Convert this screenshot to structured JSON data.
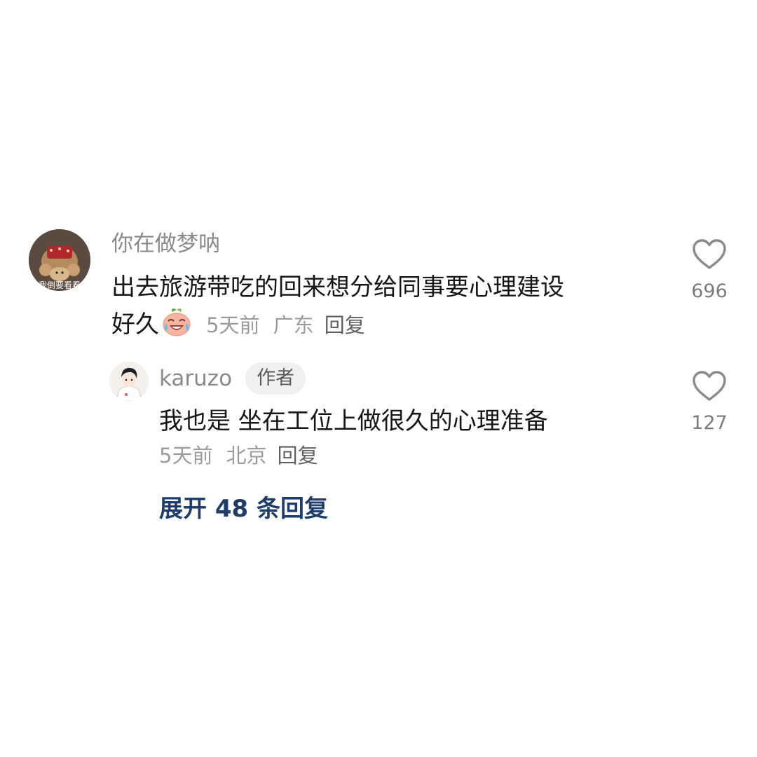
{
  "comment": {
    "username": "你在做梦呐",
    "avatar_caption": "我倒要看看",
    "text_line1": "出去旅游带吃的回来想分给同事要心理建设",
    "text_line2": "好久",
    "emoji": "crying-laughing-emoji",
    "time": "5天前",
    "location": "广东",
    "reply_label": "回复",
    "likes": "696"
  },
  "reply": {
    "username": "karuzo",
    "author_badge": "作者",
    "text": "我也是 坐在工位上做很久的心理准备",
    "time": "5天前",
    "location": "北京",
    "reply_label": "回复",
    "likes": "127"
  },
  "expand_replies": "展开 48 条回复",
  "icons": {
    "like": "heart-outline-icon"
  },
  "colors": {
    "username": "#8a8a8a",
    "text": "#161616",
    "meta": "#9b9b9b",
    "link": "#1f3d6b"
  }
}
